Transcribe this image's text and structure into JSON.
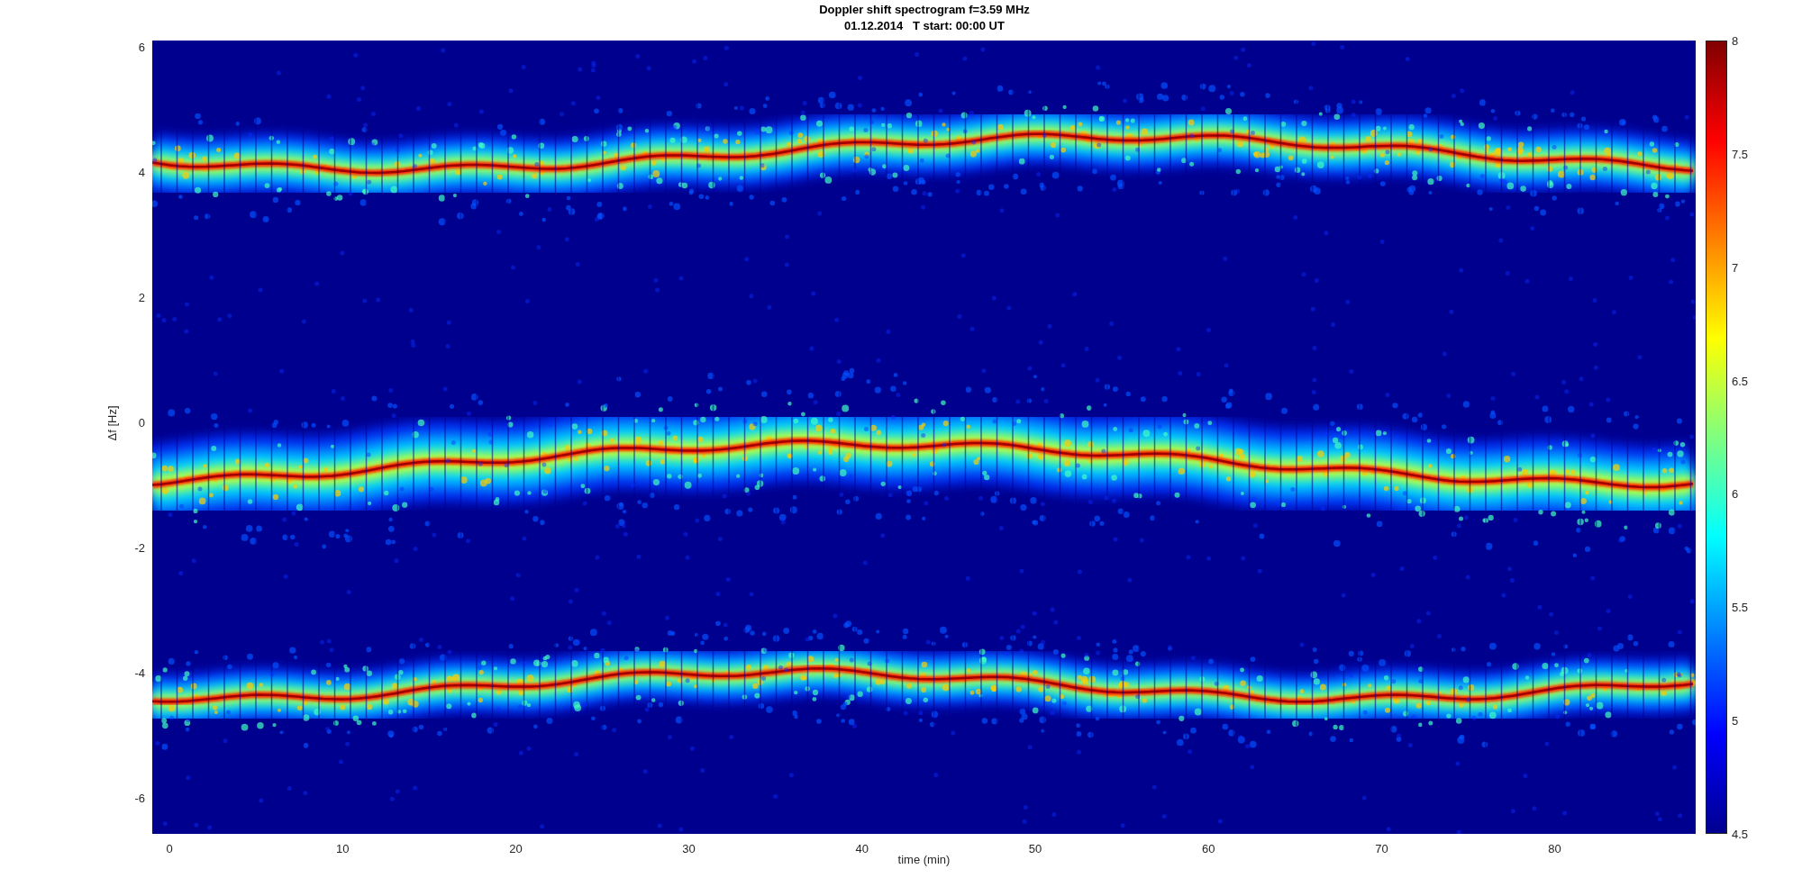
{
  "title": [
    "Doppler shift spectrogram f=3.59 MHz",
    "01.12.2014   T start: 00:00 UT"
  ],
  "axes": {
    "xlabel": "time (min)",
    "ylabel": "Δf [Hz]",
    "xticks": [
      "0",
      "10",
      "20",
      "30",
      "40",
      "50",
      "60",
      "70",
      "80"
    ],
    "yticks": [
      "6",
      "4",
      "2",
      "0",
      "-2",
      "-4",
      "-6"
    ]
  },
  "colorbar": {
    "ticks": [
      "8",
      "7.5",
      "7",
      "6.5",
      "6",
      "5.5",
      "5",
      "4.5"
    ]
  }
}
